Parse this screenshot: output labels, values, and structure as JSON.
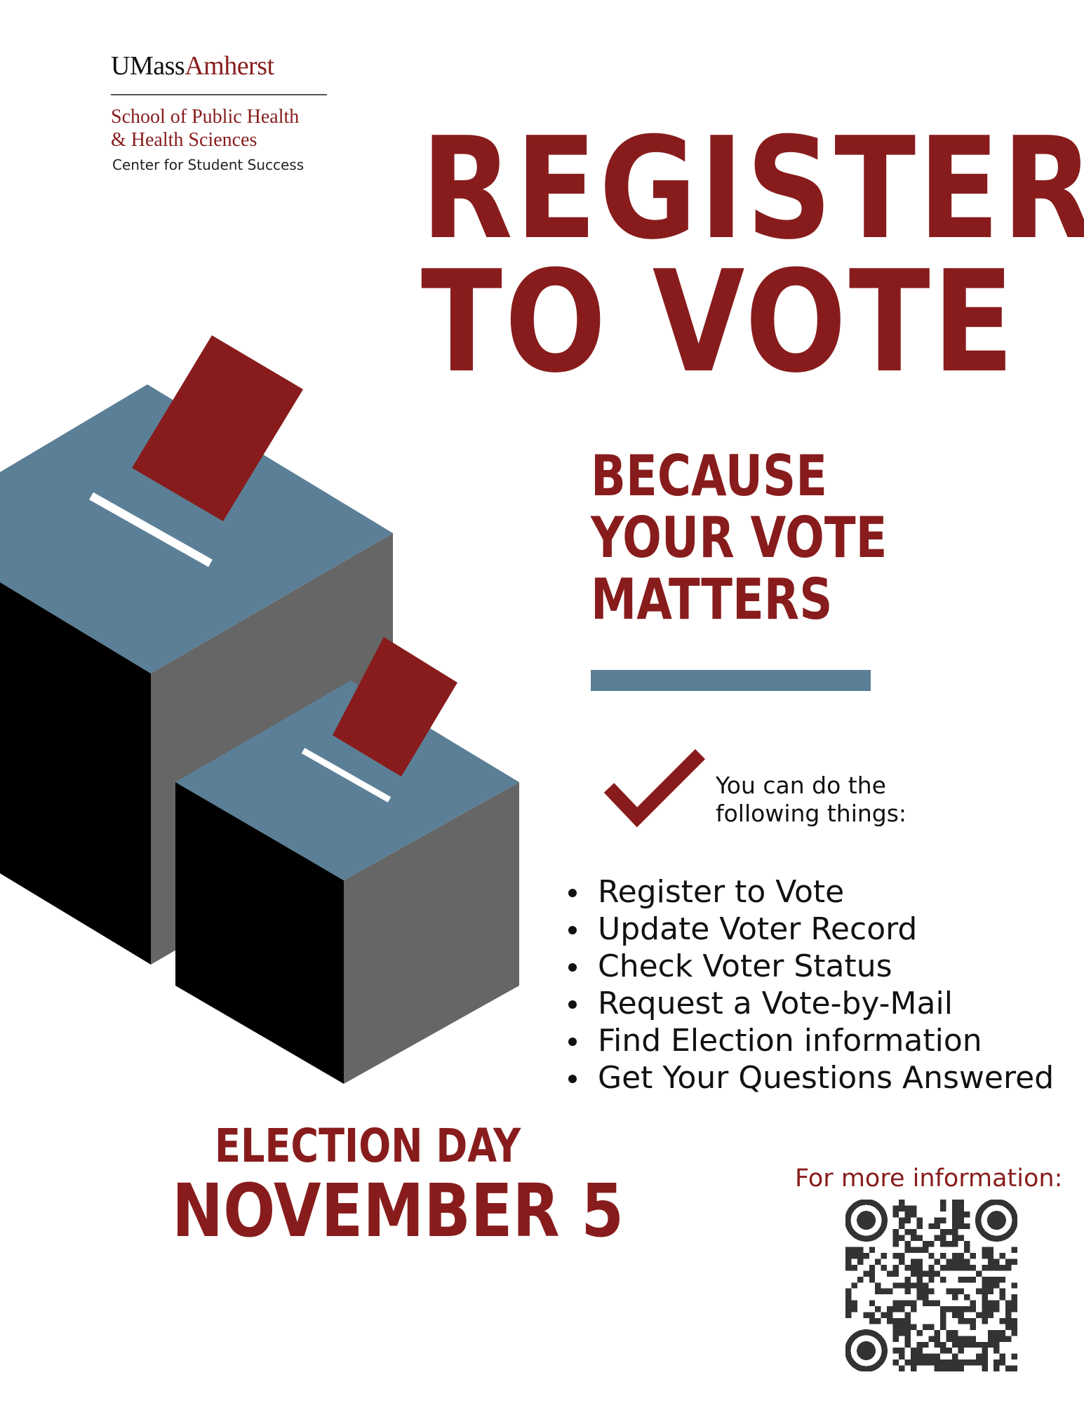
{
  "logo": {
    "umass_black": "UMass",
    "umass_red": "Amherst",
    "school_line1": "School of Public Health",
    "school_line2": "& Health Sciences",
    "center": "Center for Student Success"
  },
  "headline": {
    "line1": "REGISTER",
    "line2": "TO VOTE"
  },
  "tagline": {
    "line1": "BECAUSE",
    "line2": "YOUR VOTE",
    "line3": "MATTERS"
  },
  "intro": {
    "line1": "You can do the",
    "line2": "following things:"
  },
  "actions": [
    "Register to Vote",
    "Update Voter Record",
    "Check Voter Status",
    "Request a Vote-by-Mail",
    "Find Election information",
    "Get Your Questions Answered"
  ],
  "election": {
    "label": "ELECTION DAY",
    "date": "NOVEMBER 5"
  },
  "more_info": "For more information:",
  "colors": {
    "maroon": "#881c1c",
    "slate": "#5b7f96",
    "dark_gray": "#666666",
    "black": "#000000"
  },
  "icons": {
    "check": "check-icon",
    "qr": "qr-code"
  }
}
